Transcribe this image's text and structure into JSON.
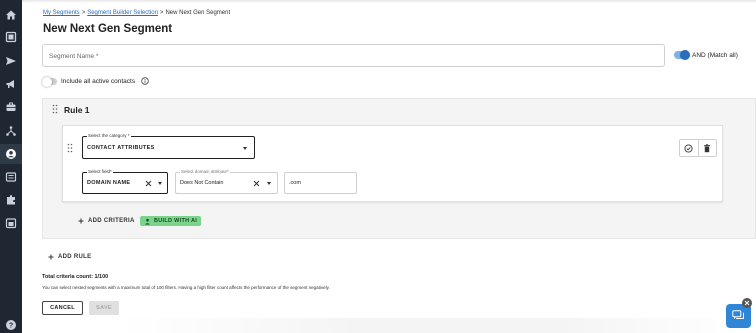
{
  "sidebar": {
    "items": [
      {
        "icon": "home-icon"
      },
      {
        "icon": "dashboard-icon"
      },
      {
        "icon": "send-icon"
      },
      {
        "icon": "megaphone-icon"
      },
      {
        "icon": "briefcase-icon"
      },
      {
        "icon": "workflow-icon"
      },
      {
        "icon": "contacts-icon",
        "active": true
      },
      {
        "icon": "library-icon"
      },
      {
        "icon": "puzzle-icon"
      },
      {
        "icon": "calendar-icon"
      },
      {
        "icon": "help-icon"
      }
    ]
  },
  "breadcrumb": {
    "items": [
      "My Segments",
      "Segment Builder Selection",
      "New Next Gen Segment"
    ],
    "separator": ">"
  },
  "page_title": "New Next Gen Segment",
  "segment_name": {
    "placeholder": "Segment Name *",
    "value": ""
  },
  "match_toggle": {
    "label": "AND (Match all)",
    "on": true
  },
  "include_contacts": {
    "label": "Include all active contacts",
    "on": false
  },
  "rule": {
    "title": "Rule 1",
    "category": {
      "label": "Select the category *",
      "value": "CONTACT ATTRIBUTES"
    },
    "field": {
      "label": "Select field*",
      "value": "DOMAIN NAME"
    },
    "domain_attribute": {
      "label": "Select domain attribute*",
      "value": "Does Not Contain"
    },
    "domain_value": {
      "value": ".com"
    },
    "add_criteria_label": "ADD CRITERIA",
    "build_ai_label": "BUILD WITH AI"
  },
  "add_rule_label": "ADD RULE",
  "total_criteria": "Total criteria count: 1/100",
  "help_text": "You can select nested segments with a maximum total of 100 filters. Having a high filter count affects the performance of the segment negatively.",
  "buttons": {
    "cancel": "CANCEL",
    "save": "SAVE"
  },
  "colors": {
    "accent": "#2a6ebb",
    "sidebar": "#1f2732",
    "ai_badge": "#7bd48b",
    "chat": "#2f86d6"
  }
}
